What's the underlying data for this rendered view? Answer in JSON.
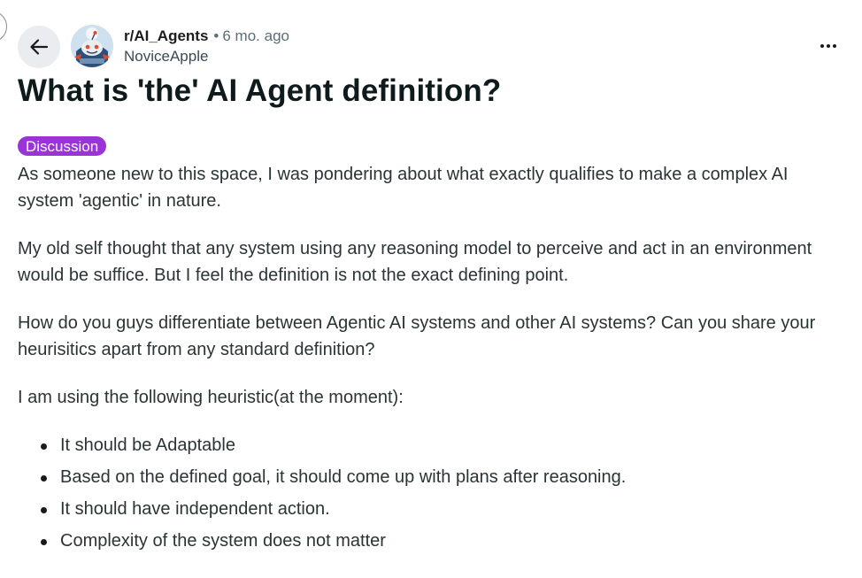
{
  "header": {
    "subreddit": "r/AI_Agents",
    "separator": "•",
    "time_ago": "6 mo. ago",
    "author": "NoviceApple"
  },
  "post": {
    "title": "What is 'the' AI Agent definition?",
    "flair": "Discussion",
    "flair_color": "#9a34d6",
    "paragraphs": [
      "As someone new to this space, I was pondering about what exactly qualifies to make a complex AI system 'agentic' in nature.",
      "My old self thought that any system using any reasoning model to perceive and act in an environment would be suffice. But I feel the definition is not the exact defining point.",
      "How do you guys differentiate between Agentic AI systems and other AI systems? Can you share your heurisitics apart from any standard definition?",
      "I am using the following heuristic(at the moment):"
    ],
    "bullets": [
      "It should be Adaptable",
      "Based on the defined goal, it should come up with plans after reasoning.",
      "It should have independent action.",
      "Complexity of the system does not matter"
    ]
  },
  "icons": {
    "back": "arrow-left-icon",
    "more": "more-horizontal-icon",
    "avatar": "subreddit-avatar"
  }
}
